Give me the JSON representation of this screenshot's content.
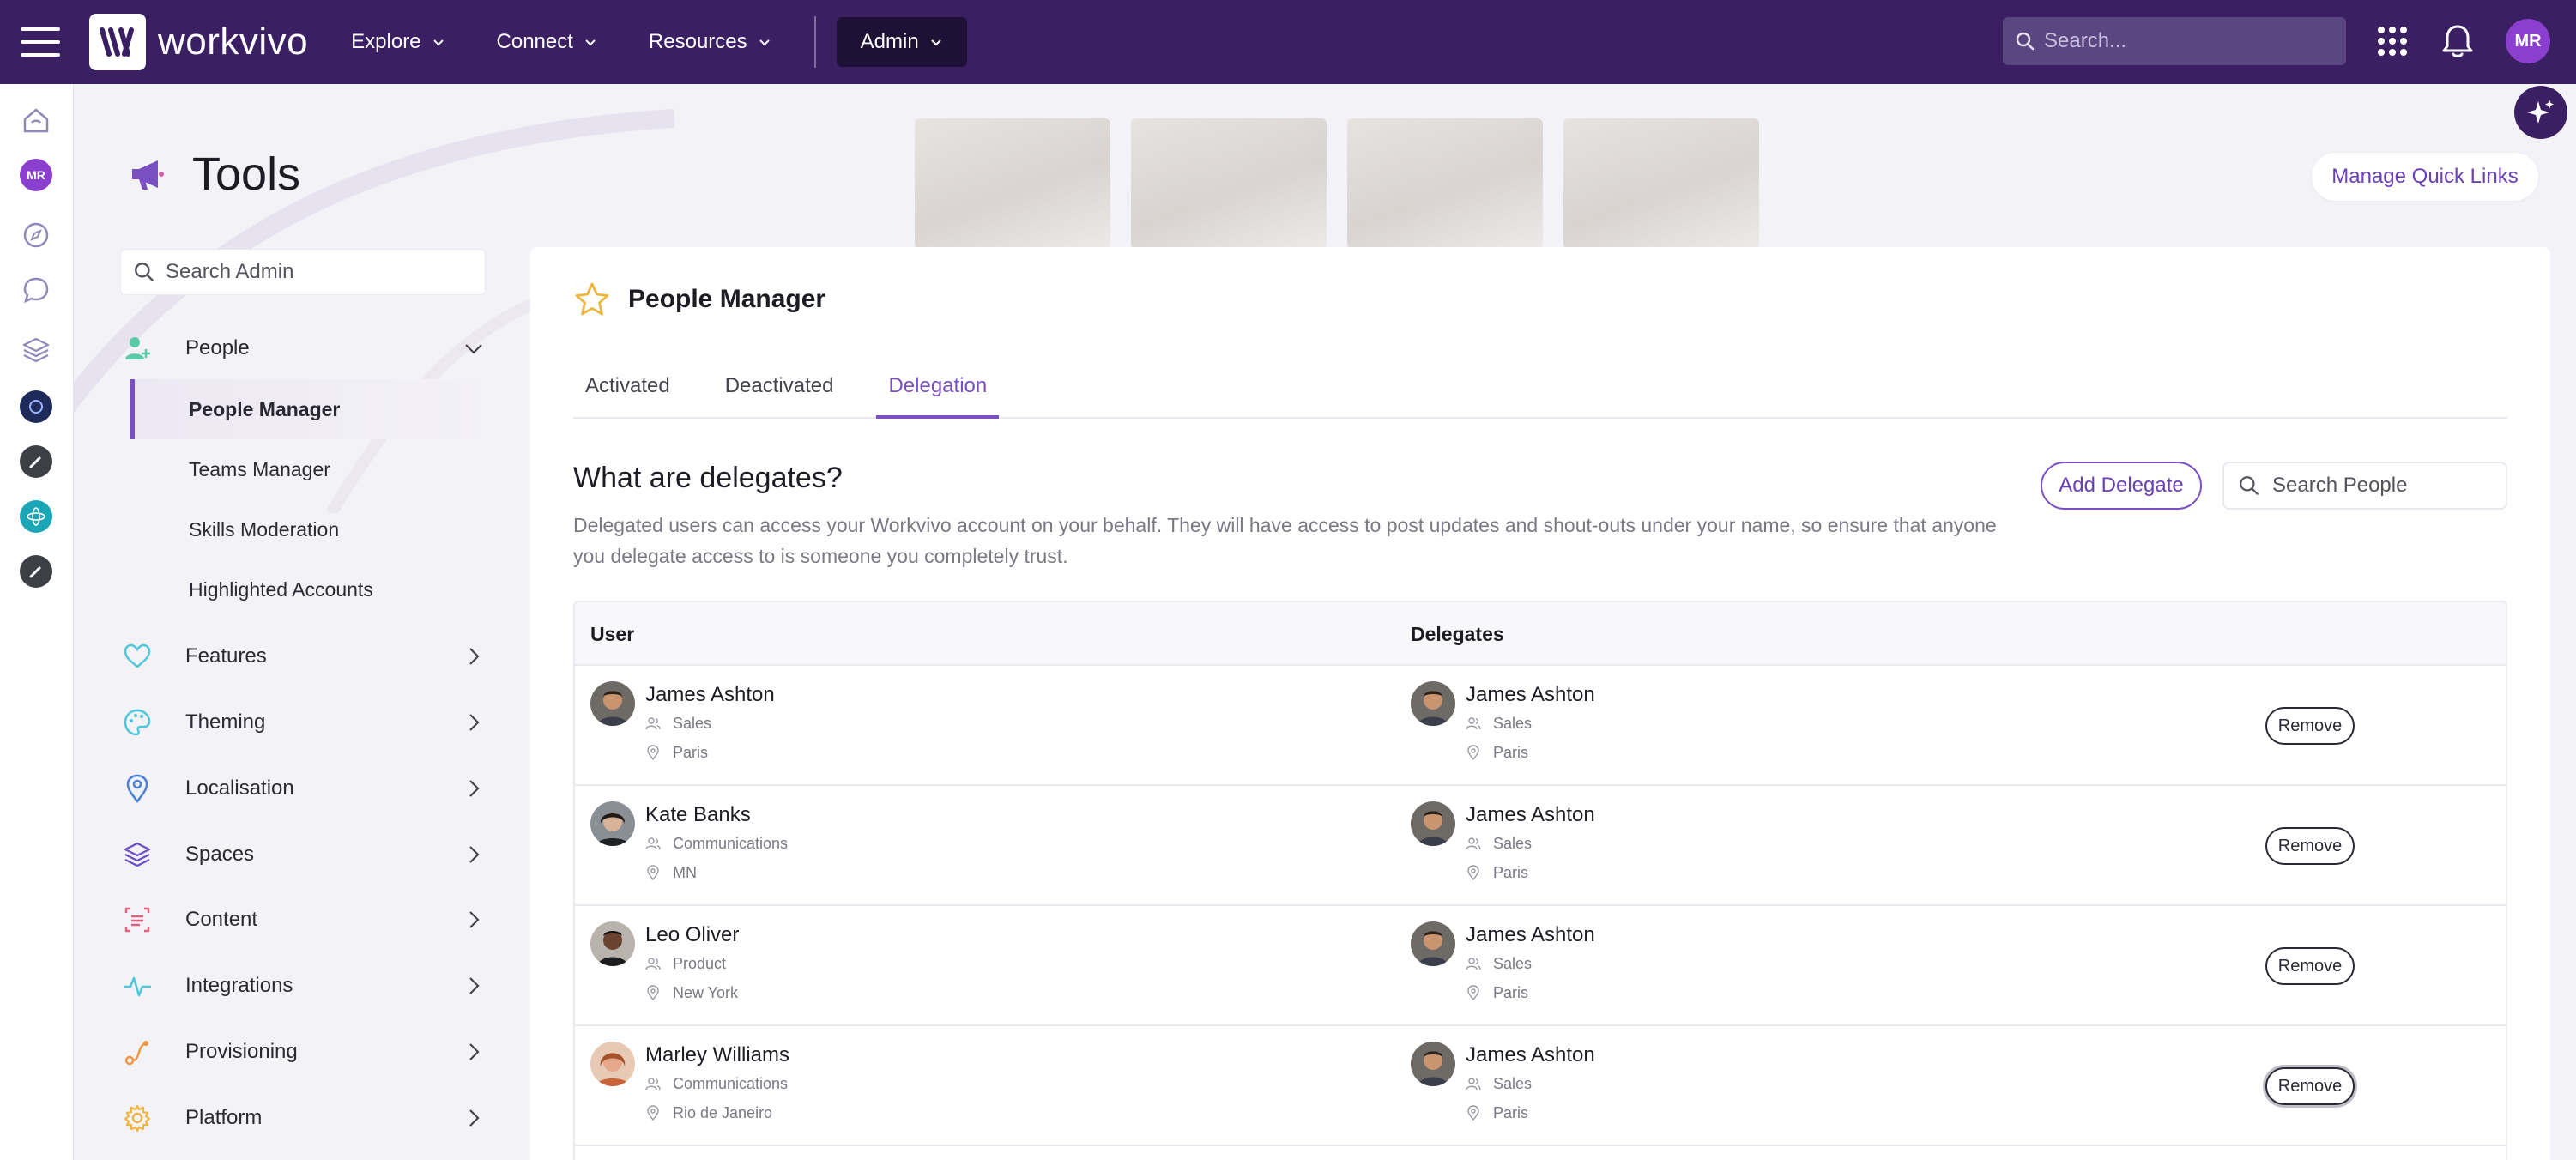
{
  "topbar": {
    "brand": "workvivo",
    "nav": [
      {
        "label": "Explore"
      },
      {
        "label": "Connect"
      },
      {
        "label": "Resources"
      }
    ],
    "admin_label": "Admin",
    "search_placeholder": "Search...",
    "avatar_initials": "MR",
    "colors": {
      "background": "#3b1f63",
      "admin_button": "#1f1135",
      "search": "#5a4681",
      "avatar": "#8a3fcf"
    }
  },
  "rail": {
    "items": [
      {
        "icon": "home-icon"
      },
      {
        "icon": "avatar",
        "initials": "MR"
      },
      {
        "icon": "compass-icon"
      },
      {
        "icon": "chat-icon"
      },
      {
        "icon": "layers-icon"
      },
      {
        "icon": "space-avatar-icon"
      },
      {
        "icon": "edit-space-icon"
      },
      {
        "icon": "atom-space-icon"
      },
      {
        "icon": "edit-space-icon"
      }
    ]
  },
  "header": {
    "title": "Tools",
    "manage_quick_links": "Manage Quick Links",
    "accent": "#7a4fc4"
  },
  "sidebar": {
    "search_placeholder": "Search Admin",
    "categories": [
      {
        "label": "People",
        "icon": "person-add-icon",
        "expanded": true
      },
      {
        "label": "Features",
        "icon": "heart-icon"
      },
      {
        "label": "Theming",
        "icon": "palette-icon"
      },
      {
        "label": "Localisation",
        "icon": "location-pin-icon"
      },
      {
        "label": "Spaces",
        "icon": "layers-icon"
      },
      {
        "label": "Content",
        "icon": "content-icon"
      },
      {
        "label": "Integrations",
        "icon": "pulse-icon"
      },
      {
        "label": "Provisioning",
        "icon": "provisioning-icon"
      },
      {
        "label": "Platform",
        "icon": "gear-icon"
      }
    ],
    "people_submenu": [
      {
        "label": "People Manager",
        "active": true
      },
      {
        "label": "Teams Manager"
      },
      {
        "label": "Skills Moderation"
      },
      {
        "label": "Highlighted Accounts"
      }
    ]
  },
  "main": {
    "title": "People Manager",
    "tabs": [
      {
        "label": "Activated"
      },
      {
        "label": "Deactivated"
      },
      {
        "label": "Delegation",
        "active": true
      }
    ],
    "section_title": "What are delegates?",
    "section_description": "Delegated users can access your Workvivo account on your behalf. They will have access to post updates and shout-outs under your name, so ensure that anyone you delegate access to is someone you completely trust.",
    "add_delegate_label": "Add Delegate",
    "search_people_placeholder": "Search People",
    "table": {
      "columns": [
        "User",
        "Delegates"
      ],
      "remove_label": "Remove",
      "rows": [
        {
          "user": {
            "name": "James Ashton",
            "team": "Sales",
            "location": "Paris"
          },
          "delegate": {
            "name": "James Ashton",
            "team": "Sales",
            "location": "Paris"
          }
        },
        {
          "user": {
            "name": "Kate Banks",
            "team": "Communications",
            "location": "MN"
          },
          "delegate": {
            "name": "James Ashton",
            "team": "Sales",
            "location": "Paris"
          }
        },
        {
          "user": {
            "name": "Leo Oliver",
            "team": "Product",
            "location": "New York"
          },
          "delegate": {
            "name": "James Ashton",
            "team": "Sales",
            "location": "Paris"
          }
        },
        {
          "user": {
            "name": "Marley Williams",
            "team": "Communications",
            "location": "Rio de Janeiro"
          },
          "delegate": {
            "name": "James Ashton",
            "team": "Sales",
            "location": "Paris"
          }
        }
      ]
    }
  }
}
